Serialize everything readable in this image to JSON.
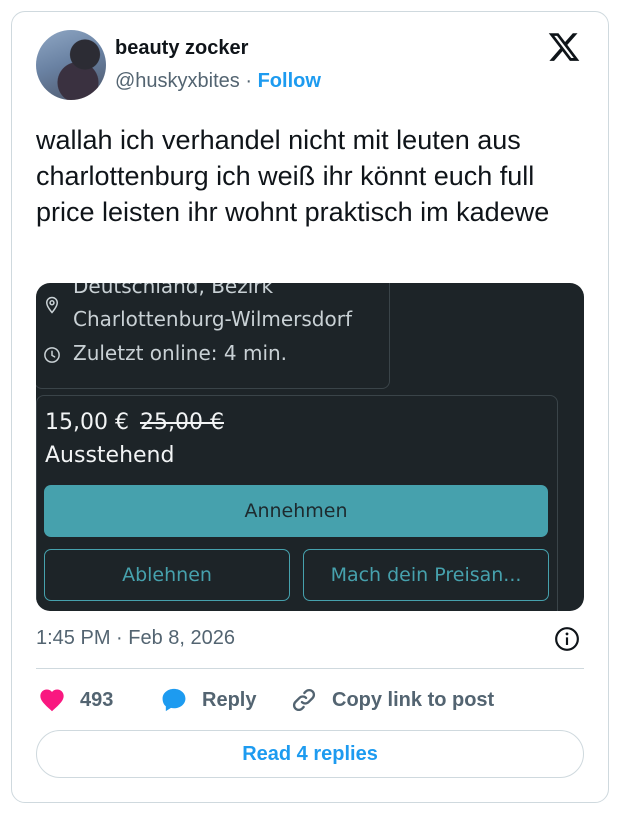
{
  "author": {
    "display_name": "beauty zocker",
    "handle": "@huskyxbites",
    "separator": "·",
    "follow_label": "Follow"
  },
  "tweet": {
    "text": "wallah ich verhandel nicht mit leuten aus charlottenburg ich weiß ihr könnt euch full price leisten ihr wohnt praktisch im kadewe"
  },
  "media": {
    "location_line1": "Deutschland, Bezirk",
    "location_line2": "Charlottenburg-Wilmersdorf",
    "last_online": "Zuletzt online: 4 min.",
    "price_new": "15,00 €",
    "price_old": "25,00 €",
    "status": "Ausstehend",
    "accept_label": "Annehmen",
    "decline_label": "Ablehnen",
    "counter_label": "Mach dein Preisan...",
    "colors": {
      "background": "#1d2428",
      "accent": "#46a1ad"
    }
  },
  "meta": {
    "timestamp": "1:45 PM · Feb 8, 2026"
  },
  "actions": {
    "likes_count": "493",
    "reply_label": "Reply",
    "copy_label": "Copy link to post",
    "read_replies_label": "Read 4 replies"
  },
  "icons": [
    "x-logo-icon",
    "pin-icon",
    "clock-icon",
    "info-icon",
    "heart-icon",
    "reply-bubble-icon",
    "link-icon"
  ],
  "colors": {
    "like": "#f91880",
    "link": "#1d9bf0",
    "muted": "#536471"
  }
}
